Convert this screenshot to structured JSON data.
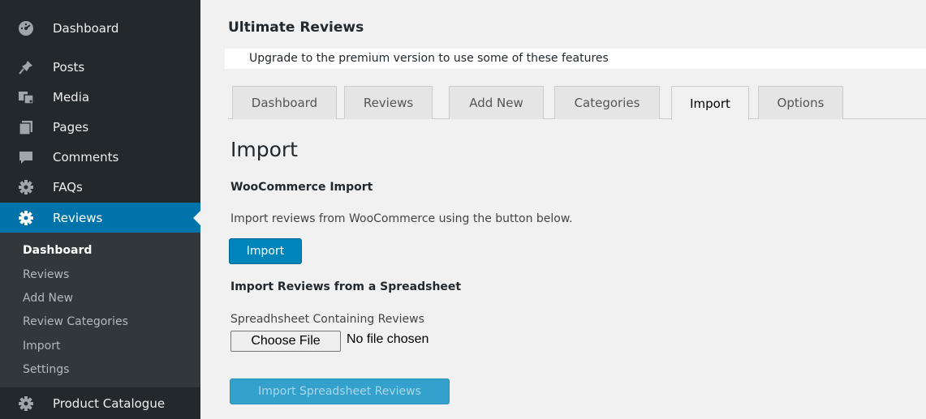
{
  "sidebar": {
    "items": [
      {
        "label": "Dashboard",
        "icon": "dashboard-icon"
      },
      {
        "label": "Posts",
        "icon": "pin-icon"
      },
      {
        "label": "Media",
        "icon": "media-icon"
      },
      {
        "label": "Pages",
        "icon": "pages-icon"
      },
      {
        "label": "Comments",
        "icon": "comment-icon"
      },
      {
        "label": "FAQs",
        "icon": "gear-icon"
      },
      {
        "label": "Reviews",
        "icon": "gear-icon"
      },
      {
        "label": "Product Catalogue",
        "icon": "gear-icon"
      }
    ],
    "active_item": "Reviews",
    "submenu": [
      "Dashboard",
      "Reviews",
      "Add New",
      "Review Categories",
      "Import",
      "Settings"
    ],
    "current_submenu": "Dashboard"
  },
  "header": {
    "title": "Ultimate Reviews",
    "notice": "Upgrade to the premium version to use some of these features"
  },
  "tabs": [
    {
      "label": "Dashboard"
    },
    {
      "label": "Reviews"
    },
    {
      "label": "Add New"
    },
    {
      "label": "Categories"
    },
    {
      "label": "Import"
    },
    {
      "label": "Options"
    }
  ],
  "active_tab": "Import",
  "main": {
    "heading": "Import",
    "woo_title": "WooCommerce Import",
    "woo_description": "Import reviews from WooCommerce using the button below.",
    "import_button": "Import",
    "spreadsheet_title": "Import Reviews from a Spreadsheet",
    "spreadsheet_label": "Spreadhsheet Containing Reviews",
    "choose_file_button": "Choose File",
    "file_status": "No file chosen",
    "import_spreadsheet_button": "Import Spreadsheet Reviews"
  },
  "colors": {
    "sidebar_bg": "#23282d",
    "submenu_bg": "#32373c",
    "accent": "#0073aa",
    "primary_button": "#0085ba",
    "disabled_button": "#33a1cc",
    "page_bg": "#f1f1f1"
  }
}
